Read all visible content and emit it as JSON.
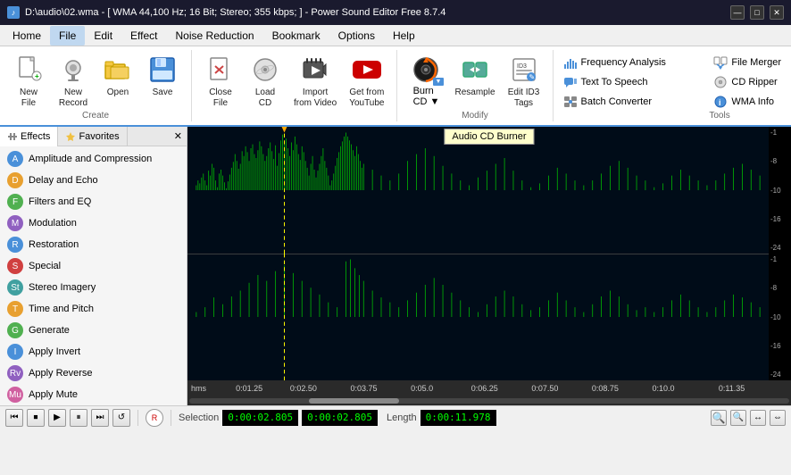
{
  "titleBar": {
    "icon": "♪",
    "title": "D:\\audio\\02.wma - [ WMA 44,100 Hz; 16 Bit; Stereo; 355 kbps; ] - Power Sound Editor Free 8.7.4",
    "controls": [
      "—",
      "□",
      "✕"
    ]
  },
  "ribbon": {
    "tabs": [
      "Home",
      "File",
      "Edit",
      "Effect",
      "Noise Reduction",
      "Bookmark",
      "Options",
      "Help"
    ],
    "activeTab": "File",
    "groups": {
      "create": {
        "label": "Create",
        "buttons": [
          {
            "id": "new-file",
            "icon": "📄",
            "label": "New\nFile"
          },
          {
            "id": "new-record",
            "icon": "🎙",
            "label": "New\nRecord"
          },
          {
            "id": "open",
            "icon": "📂",
            "label": "Open"
          },
          {
            "id": "save",
            "icon": "💾",
            "label": "Save"
          }
        ]
      },
      "create2": {
        "buttons": [
          {
            "id": "close-file",
            "icon": "✕",
            "label": "Close\nFile"
          },
          {
            "id": "load-cd",
            "icon": "💿",
            "label": "Load\nCD"
          },
          {
            "id": "import-video",
            "icon": "🎬",
            "label": "Import\nfrom Video"
          },
          {
            "id": "get-youtube",
            "icon": "▶",
            "label": "Get from\nYouTube",
            "color": "red"
          }
        ]
      },
      "modify": {
        "label": "Modify",
        "buttons": [
          {
            "id": "burn-cd",
            "icon": "🔥",
            "label": "Burn\nCD"
          },
          {
            "id": "resample",
            "icon": "↕",
            "label": "Resample"
          },
          {
            "id": "edit-id3",
            "icon": "🏷",
            "label": "Edit ID3\nTags"
          }
        ]
      },
      "tools": {
        "label": "Tools",
        "items": [
          {
            "id": "frequency-analysis",
            "icon": "📊",
            "label": "Frequency Analysis"
          },
          {
            "id": "text-to-speech",
            "icon": "🔊",
            "label": "Text To Speech"
          },
          {
            "id": "batch-converter",
            "icon": "⚙",
            "label": "Batch Converter"
          },
          {
            "id": "file-merger",
            "icon": "📋",
            "label": "File Merger"
          },
          {
            "id": "cd-ripper",
            "icon": "💿",
            "label": "CD Ripper"
          },
          {
            "id": "wma-info",
            "icon": "ℹ",
            "label": "WMA Info"
          }
        ]
      }
    }
  },
  "effectsPanel": {
    "tabs": [
      "Effects",
      "Favorites"
    ],
    "activeTab": "Effects",
    "items": [
      {
        "id": "amplitude",
        "icon": "A",
        "color": "ei-blue",
        "label": "Amplitude and Compression"
      },
      {
        "id": "delay",
        "icon": "D",
        "color": "ei-orange",
        "label": "Delay and Echo"
      },
      {
        "id": "filters",
        "icon": "F",
        "color": "ei-green",
        "label": "Filters and EQ"
      },
      {
        "id": "modulation",
        "icon": "M",
        "color": "ei-purple",
        "label": "Modulation"
      },
      {
        "id": "restoration",
        "icon": "R",
        "color": "ei-blue",
        "label": "Restoration"
      },
      {
        "id": "special",
        "icon": "S",
        "color": "ei-red",
        "label": "Special"
      },
      {
        "id": "stereo",
        "icon": "St",
        "color": "ei-teal",
        "label": "Stereo Imagery"
      },
      {
        "id": "time-pitch",
        "icon": "T",
        "color": "ei-orange",
        "label": "Time and Pitch"
      },
      {
        "id": "generate",
        "icon": "G",
        "color": "ei-green",
        "label": "Generate"
      },
      {
        "id": "apply-invert",
        "icon": "I",
        "color": "ei-blue",
        "label": "Apply Invert"
      },
      {
        "id": "apply-reverse",
        "icon": "Rv",
        "color": "ei-purple",
        "label": "Apply Reverse"
      },
      {
        "id": "apply-mute",
        "icon": "Mu",
        "color": "ei-pink",
        "label": "Apply Mute"
      }
    ]
  },
  "waveform": {
    "tooltip": "Audio CD Burner",
    "timeMarks": [
      "hms",
      "0:01.25",
      "0:02.50",
      "0:03.75",
      "0:05.0",
      "0:06.25",
      "0:07.50",
      "0:08.75",
      "0:10.0",
      "0:11.35"
    ],
    "dbScale1": [
      "-1",
      "-8",
      "-10",
      "-16",
      "-24"
    ],
    "dbScale2": [
      "-1",
      "-8",
      "-10",
      "-16",
      "-24"
    ],
    "cursorTime": "0:02.50"
  },
  "statusBar": {
    "transportButtons": [
      "⏮",
      "⏹",
      "⏺",
      "⏭",
      "⏵",
      "⏸"
    ],
    "recLabel": "R",
    "selectionLabel": "Selection",
    "selectionStart": "0:00:02.805",
    "selectionEnd": "0:00:02.805",
    "lengthLabel": "Length",
    "length": "0:00:11.978",
    "zoomButtons": [
      "🔍+",
      "🔍-",
      "↔",
      "⇔"
    ]
  }
}
